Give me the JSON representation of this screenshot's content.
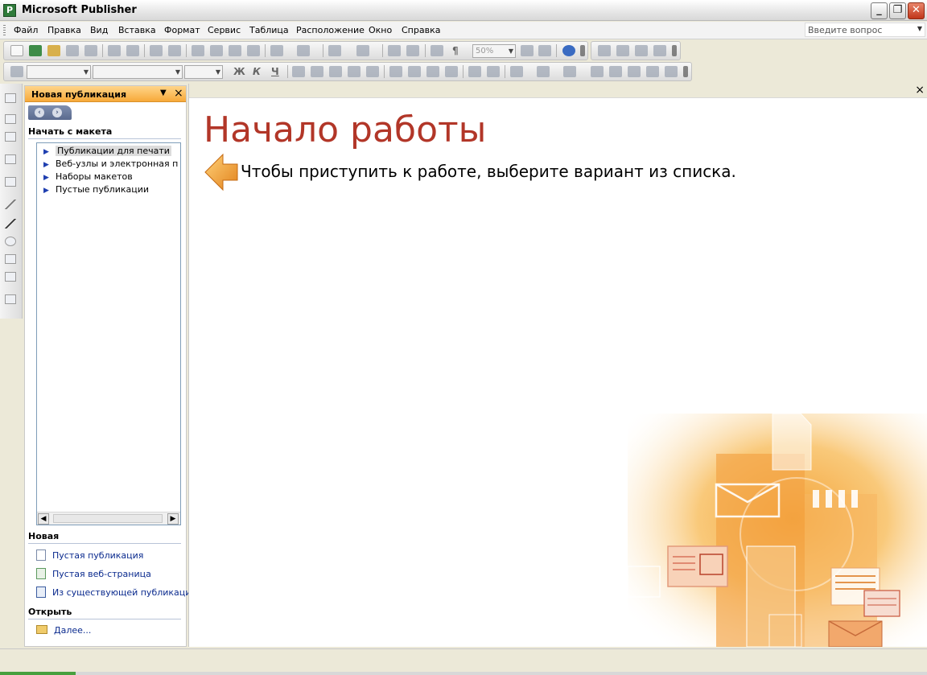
{
  "window": {
    "title": "Microsoft Publisher",
    "app_icon_letter": "P",
    "minimize": "_",
    "restore": "❐",
    "close": "✕"
  },
  "menu": {
    "items": [
      "Файл",
      "Правка",
      "Вид",
      "Вставка",
      "Формат",
      "Сервис",
      "Таблица",
      "Расположение",
      "Окно",
      "Справка"
    ],
    "help_placeholder": "Введите вопрос"
  },
  "toolbar": {
    "zoom_value": "50%",
    "bold": "Ж",
    "italic": "К",
    "underline": "Ч"
  },
  "task_pane": {
    "title": "Новая публикация",
    "section_start": "Начать с макета",
    "templates": [
      {
        "label": "Публикации для печати",
        "selected": true
      },
      {
        "label": "Веб-узлы и электронная почта",
        "selected": false
      },
      {
        "label": "Наборы макетов",
        "selected": false
      },
      {
        "label": "Пустые публикации",
        "selected": false
      }
    ],
    "section_new": "Новая",
    "new_links": [
      "Пустая публикация",
      "Пустая веб-страница",
      "Из существующей публикации..."
    ],
    "section_open": "Открыть",
    "open_link": "Далее..."
  },
  "main": {
    "heading": "Начало работы",
    "instruction": "Чтобы приступить к работе, выберите вариант из списка."
  },
  "colors": {
    "heading": "#b23628",
    "pane_header": "#f7a93a",
    "link": "#0a2a8e"
  }
}
